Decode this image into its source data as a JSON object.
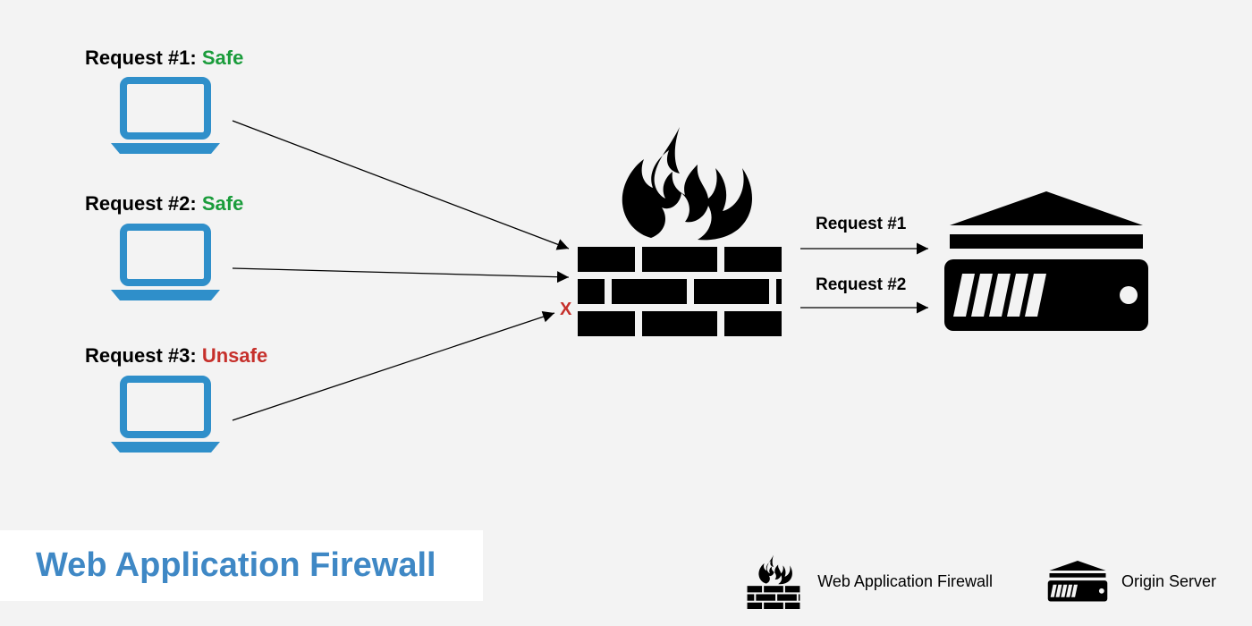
{
  "requests": [
    {
      "label_prefix": "Request #1: ",
      "status": "Safe",
      "status_class": "safe"
    },
    {
      "label_prefix": "Request #2: ",
      "status": "Safe",
      "status_class": "safe"
    },
    {
      "label_prefix": "Request #3: ",
      "status": "Unsafe",
      "status_class": "unsafe"
    }
  ],
  "outgoing": [
    {
      "label": "Request #1"
    },
    {
      "label": "Request #2"
    }
  ],
  "blocked_marker": "X",
  "title": "Web Application Firewall",
  "legend": {
    "firewall": "Web Application Firewall",
    "server": "Origin Server"
  },
  "colors": {
    "laptop": "#2f8fca",
    "safe": "#1a9c3b",
    "unsafe": "#c6302b",
    "title": "#3f88c5"
  }
}
